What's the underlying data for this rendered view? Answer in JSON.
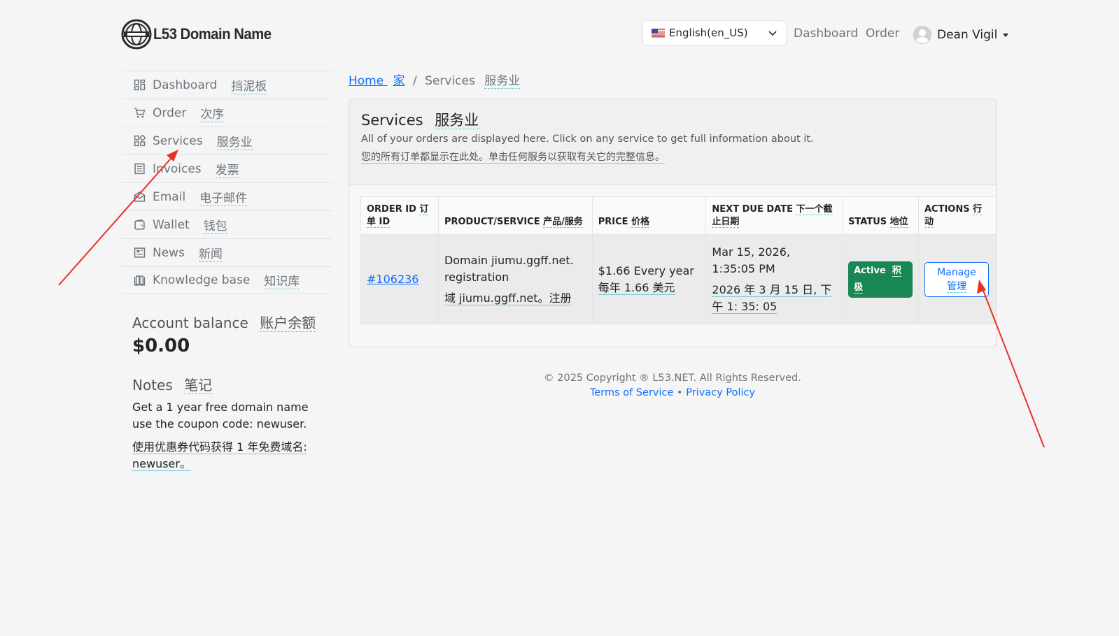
{
  "header": {
    "logo_text": "L53 Domain Name",
    "language": "English(en_US)",
    "nav": [
      "Dashboard",
      "Order"
    ],
    "user_name": "Dean Vigil"
  },
  "sidebar": {
    "items": [
      {
        "label": "Dashboard",
        "zh": "挡泥板",
        "icon": "dashboard-icon"
      },
      {
        "label": "Order",
        "zh": "次序",
        "icon": "cart-icon"
      },
      {
        "label": "Services",
        "zh": "服务业",
        "icon": "services-icon"
      },
      {
        "label": "Invoices",
        "zh": "发票",
        "icon": "invoice-icon"
      },
      {
        "label": "Email",
        "zh": "电子邮件",
        "icon": "email-icon"
      },
      {
        "label": "Wallet",
        "zh": "钱包",
        "icon": "wallet-icon"
      },
      {
        "label": "News",
        "zh": "新闻",
        "icon": "news-icon"
      },
      {
        "label": "Knowledge base",
        "zh": "知识库",
        "icon": "book-icon"
      }
    ],
    "balance_title": "Account balance",
    "balance_title_zh": "账户余额",
    "balance_amount": "$0.00",
    "notes_title": "Notes",
    "notes_title_zh": "笔记",
    "notes_text": "Get a 1 year free domain name use the coupon code: newuser.",
    "notes_text_zh": "使用优惠券代码获得 1 年免费域名: newuser。"
  },
  "breadcrumb": {
    "home": "Home",
    "home_zh": "家",
    "separator": "/",
    "current": "Services",
    "current_zh": "服务业"
  },
  "card": {
    "title": "Services",
    "title_zh": "服务业",
    "subtitle": "All of your orders are displayed here. Click on any service to get full information about it.",
    "subtitle_zh": "您的所有订单都显示在此处。单击任何服务以获取有关它的完整信息。"
  },
  "table": {
    "headers": [
      {
        "en": "ORDER ID",
        "zh": "订单 ID"
      },
      {
        "en": "PRODUCT/SERVICE",
        "zh": "产品/服务"
      },
      {
        "en": "PRICE",
        "zh": "价格"
      },
      {
        "en": "NEXT DUE DATE",
        "zh": "下一个截止日期"
      },
      {
        "en": "STATUS",
        "zh": "地位"
      },
      {
        "en": "ACTIONS",
        "zh": "行动"
      }
    ],
    "rows": [
      {
        "order_id": "#106236",
        "product": "Domain jiumu.ggff.net. registration",
        "product_zh": "域 jiumu.ggff.net。注册",
        "price": "$1.66 Every year",
        "price_zh": "每年 1.66 美元",
        "due_date": "Mar 15, 2026, 1:35:05 PM",
        "due_date_zh": "2026 年 3 月 15 日, 下午 1: 35: 05",
        "status": "Active",
        "status_zh": "积极",
        "action": "Manage",
        "action_zh": "管理"
      }
    ]
  },
  "footer": {
    "copyright": "© 2025 Copyright ® L53.NET. All Rights Reserved.",
    "terms": "Terms of Service",
    "dot": "•",
    "privacy": "Privacy Policy"
  },
  "colors": {
    "link": "#0d6efd",
    "active_badge": "#198754",
    "annotation_arrow": "#e8302a"
  }
}
